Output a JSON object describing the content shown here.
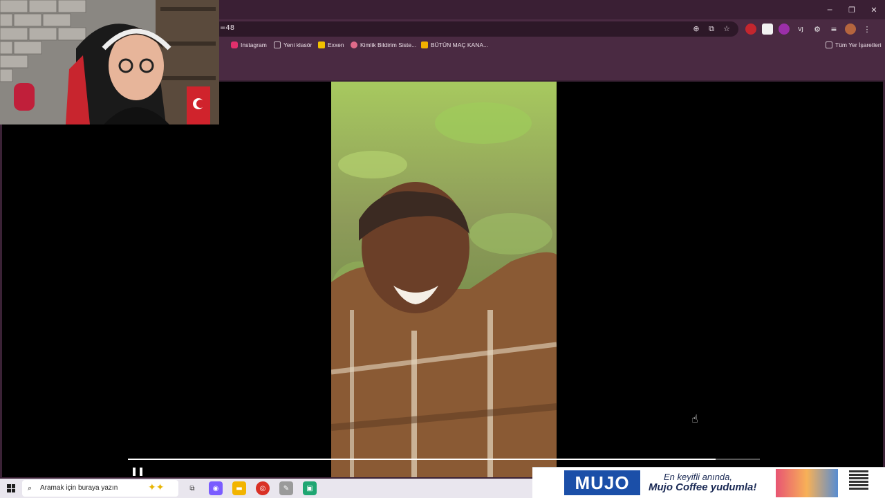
{
  "browser": {
    "address_text": "=48",
    "window_controls": {
      "minimize": "─",
      "restore": "❐",
      "close": "✕"
    },
    "omni_icons": [
      "zoom-icon",
      "cast-icon",
      "star-icon"
    ],
    "bookmarks": [
      {
        "label": "Instagram",
        "icon": "instagram-icon",
        "color": "#e1306c"
      },
      {
        "label": "Yeni klasör",
        "icon": "folder-icon",
        "color": "#cfc3cb"
      },
      {
        "label": "Exxen",
        "icon": "exxen-icon",
        "color": "#f2c200"
      },
      {
        "label": "Kimlik Bildirim Siste...",
        "icon": "feather-icon",
        "color": "#e06a8a"
      },
      {
        "label": "BÜTÜN MAÇ KANA...",
        "icon": "jp-icon",
        "color": "#f2b100"
      }
    ],
    "all_bookmarks_label": "Tüm Yer İşaretleri"
  },
  "video": {
    "progress_fraction": 0.93,
    "pause_glyph": "❚❚"
  },
  "taskbar": {
    "search_placeholder": "Aramak için buraya yazın",
    "apps": [
      {
        "name": "task-view-icon",
        "glyph": "⧉",
        "color": "#444"
      },
      {
        "name": "copilot-icon",
        "glyph": "◉",
        "color": "#7a5cff"
      },
      {
        "name": "file-explorer-icon",
        "glyph": "▬",
        "color": "#f2b400"
      },
      {
        "name": "chrome-icon",
        "glyph": "◎",
        "color": "#d93025"
      },
      {
        "name": "app-icon",
        "glyph": "✎",
        "color": "#9a9a9a"
      },
      {
        "name": "chat-app-icon",
        "glyph": "▣",
        "color": "#1fa672"
      }
    ]
  },
  "ad": {
    "brand": "MUJO",
    "line1": "En keyifli anında,",
    "line2": "Mujo Coffee yudumla!"
  }
}
